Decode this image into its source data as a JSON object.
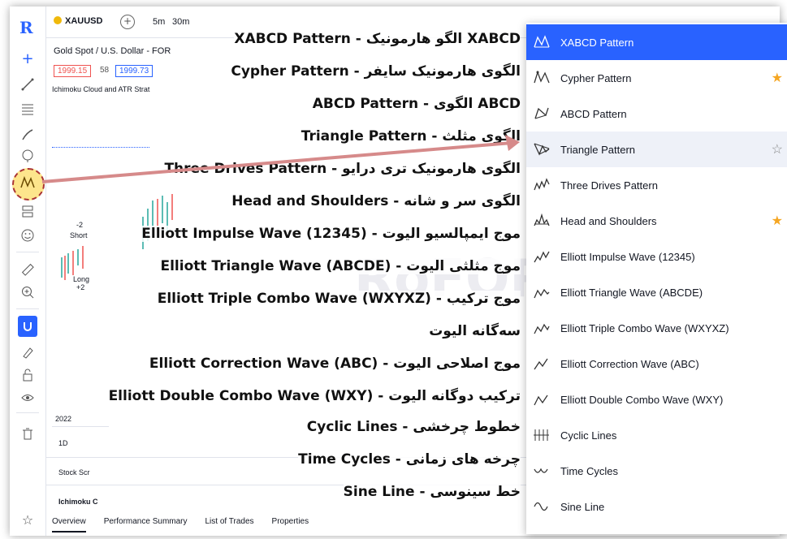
{
  "topbar": {
    "symbol": "XAUUSD",
    "add_symbol": "+",
    "timeframes": [
      "5m",
      "30m"
    ]
  },
  "chart": {
    "title": "Gold Spot / U.S. Dollar - FOR",
    "sell_price": "1999.15",
    "spread": "58",
    "buy_price": "1999.73",
    "indicator": "Ichimoku Cloud and ATR Strat",
    "short_label": "Short",
    "short_value": "-2",
    "long_label": "Long",
    "long_value": "+2",
    "year": "2022",
    "interval": "1D",
    "stock_screener": "Stock Scr",
    "strategy_name": "Ichimoku C",
    "bottom_tabs": [
      "Overview",
      "Performance Summary",
      "List of Trades",
      "Properties"
    ]
  },
  "watermark": "RoFOREX",
  "annotations": [
    "XABCD Pattern - الگو هارمونیک XABCD",
    "Cypher Pattern - الگوی هارمونیک سایفر",
    "ABCD Pattern - الگوی ABCD",
    "Triangle Pattern - الگوی مثلث",
    "Three Drives Pattern - الگوی هارمونیک تری درایو",
    "Head and Shoulders - الگوی سر و شانه",
    "Elliott Impulse Wave (12345) - موج ایمپالسیو الیوت",
    "Elliott Triangle Wave (ABCDE) - موج مثلثی الیوت",
    "Elliott Triple Combo Wave (WXYXZ) - موج ترکیب",
    "سه‌گانه الیوت",
    "Elliott Correction Wave (ABC) - موج اصلاحی الیوت",
    "Elliott Double Combo Wave (WXY) - ترکیب دوگانه الیوت",
    "Cyclic Lines - خطوط چرخشی",
    "Time Cycles - چرخه های زمانی",
    "Sine Line - خط سینوسی"
  ],
  "menu": {
    "items": [
      {
        "label": "XABCD Pattern",
        "icon": "xabcd-icon",
        "state": "selected",
        "star": "none"
      },
      {
        "label": "Cypher Pattern",
        "icon": "cypher-icon",
        "state": "normal",
        "star": "filled"
      },
      {
        "label": "ABCD Pattern",
        "icon": "abcd-icon",
        "state": "normal",
        "star": "none"
      },
      {
        "label": "Triangle Pattern",
        "icon": "triangle-pattern-icon",
        "state": "hover",
        "star": "empty"
      },
      {
        "label": "Three Drives Pattern",
        "icon": "three-drives-icon",
        "state": "normal",
        "star": "none"
      },
      {
        "label": "Head and Shoulders",
        "icon": "head-shoulders-icon",
        "state": "normal",
        "star": "filled"
      },
      {
        "label": "Elliott Impulse Wave (12345)",
        "icon": "elliott-impulse-icon",
        "state": "normal",
        "star": "none"
      },
      {
        "label": "Elliott Triangle Wave (ABCDE)",
        "icon": "elliott-triangle-icon",
        "state": "normal",
        "star": "none"
      },
      {
        "label": "Elliott Triple Combo Wave (WXYXZ)",
        "icon": "elliott-triple-icon",
        "state": "normal",
        "star": "none"
      },
      {
        "label": "Elliott Correction Wave (ABC)",
        "icon": "elliott-correction-icon",
        "state": "normal",
        "star": "none"
      },
      {
        "label": "Elliott Double Combo Wave (WXY)",
        "icon": "elliott-double-icon",
        "state": "normal",
        "star": "none"
      },
      {
        "label": "Cyclic Lines",
        "icon": "cyclic-lines-icon",
        "state": "normal",
        "star": "none"
      },
      {
        "label": "Time Cycles",
        "icon": "time-cycles-icon",
        "state": "normal",
        "star": "none"
      },
      {
        "label": "Sine Line",
        "icon": "sine-line-icon",
        "state": "normal",
        "star": "none"
      }
    ]
  },
  "colors": {
    "accent": "#2962ff",
    "star": "#f5a623",
    "highlight": "#fde58c",
    "arrow": "#d68a8a"
  }
}
